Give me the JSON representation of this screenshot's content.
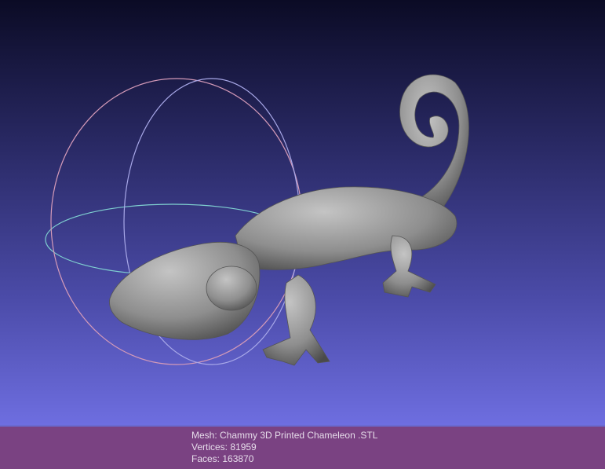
{
  "info": {
    "mesh": "Mesh: Chammy 3D Printed Chameleon .STL",
    "vertices": "Vertices: 81959",
    "faces": "Faces: 163870"
  },
  "colors": {
    "mesh": "#8c8c8c",
    "footer": "#7a4282"
  }
}
